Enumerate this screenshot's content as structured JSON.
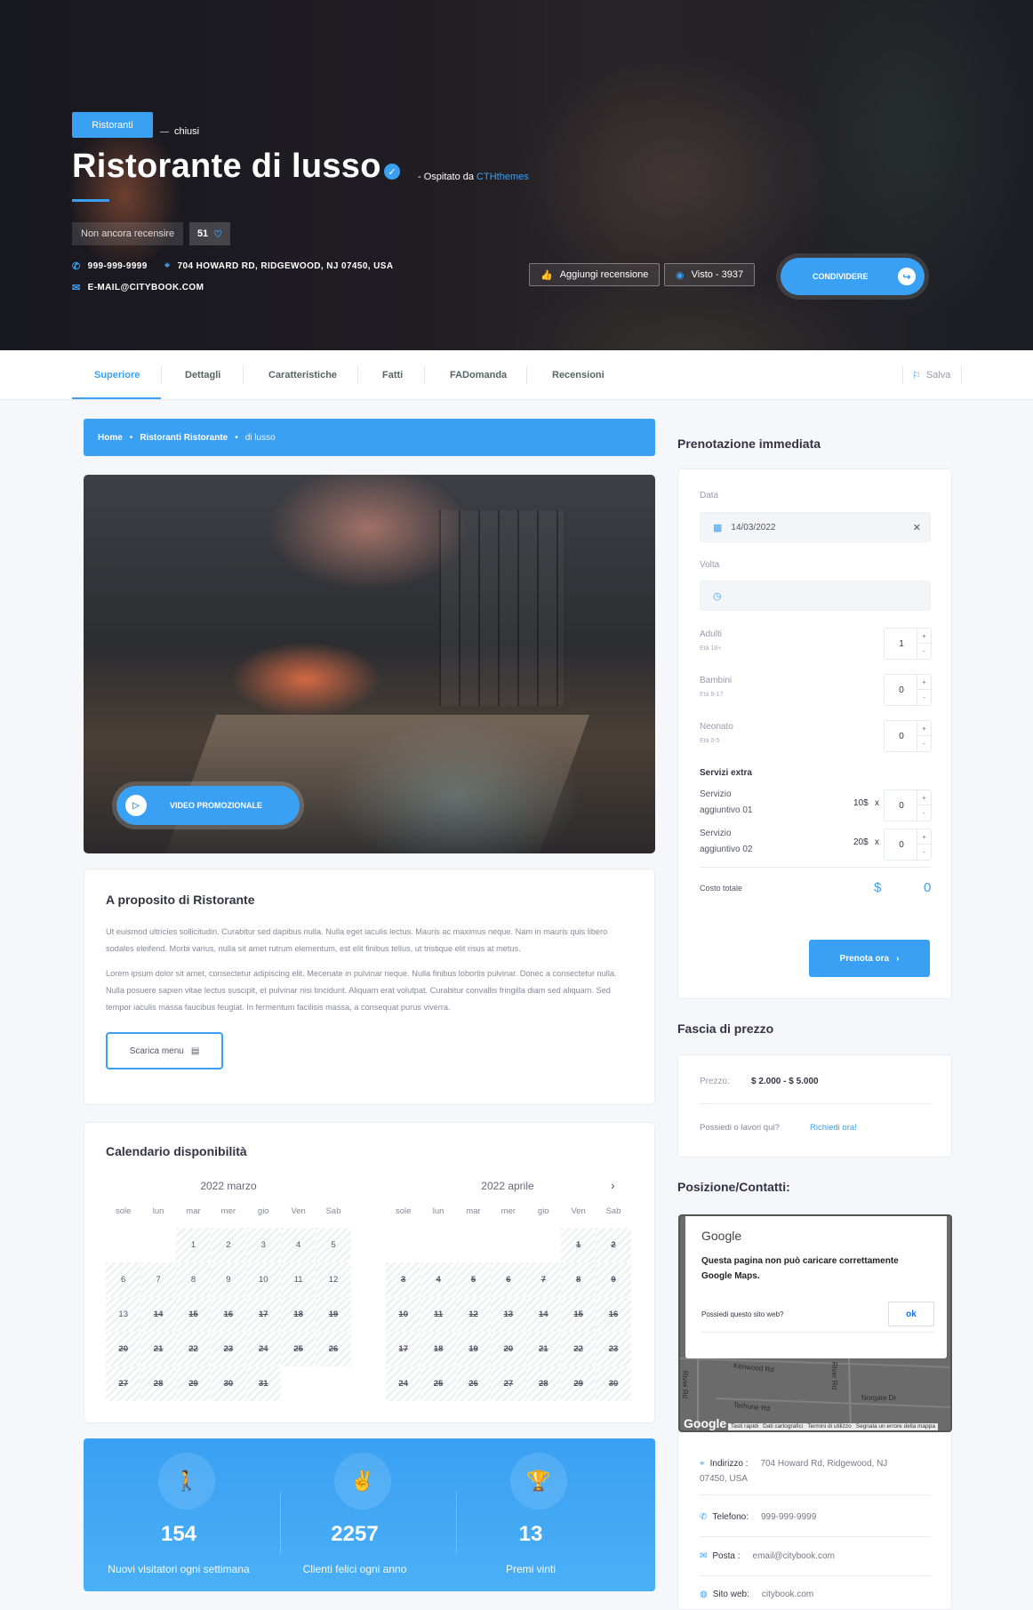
{
  "hero": {
    "category": "Ristoranti",
    "status": "chiusi",
    "title": "Ristorante di lusso",
    "hosted_prefix": "- Ospitato da",
    "hosted_by": "CTHthemes",
    "review_text": "Non ancora recensire",
    "rating": "51",
    "phone": "999-999-9999",
    "address": "704 HOWARD RD, RIDGEWOOD, NJ 07450, USA",
    "email": "E-MAIL@CITYBOOK.COM",
    "add_review": "Aggiungi recensione",
    "views": "Visto - 3937",
    "share": "CONDIVIDERE"
  },
  "tabs": [
    "Superiore",
    "Dettagli",
    "Caratteristiche",
    "Fatti",
    "FADomanda",
    "Recensioni"
  ],
  "save_label": "Salva",
  "breadcrumb": {
    "home": "Home",
    "category": "Ristoranti Ristorante",
    "current": "di lusso"
  },
  "video_label": "VIDEO PROMOZIONALE",
  "about": {
    "title": "A proposito di Ristorante",
    "p1": "Ut euismod ultricies sollicitudin. Curabitur sed dapibus nulla. Nulla eget iaculis lectus. Mauris ac maximus neque. Nam in mauris quis libero sodales eleifend. Morbi varius, nulla sit amet rutrum elementum, est elit finibus tellus, ut tristique elit risus at metus.",
    "p2": "Lorem ipsum dolor sit amet, consectetur adipiscing elit. Mecenate in pulvinar neque. Nulla finibus lobortis pulvinar. Donec a consectetur nulla. Nulla posuere sapien vitae lectus suscipit, et pulvinar nisi tincidunt. Aliquam erat volutpat. Curabitur convallis fringilla diam sed aliquam. Sed tempor iaculis massa faucibus feugiat. In fermentum facilisis massa, a consequat purus viverra.",
    "download": "Scarica menu"
  },
  "calendar": {
    "title": "Calendario disponibilità",
    "weekdays": [
      "sole",
      "lun",
      "mar",
      "mer",
      "gio",
      "Ven",
      "Sab"
    ],
    "months": [
      {
        "name": "2022 marzo",
        "offset": 2,
        "days": 31,
        "struck_from": 14
      },
      {
        "name": "2022 aprile",
        "offset": 5,
        "days": 30,
        "struck_from": 1
      }
    ],
    "next": "›"
  },
  "stats": [
    {
      "icon": "person-icon",
      "glyph": "🚶",
      "value": "154",
      "label": "Nuovi visitatori ogni settimana"
    },
    {
      "icon": "hand-icon",
      "glyph": "✌",
      "value": "2257",
      "label": "Clienti felici ogni anno"
    },
    {
      "icon": "trophy-icon",
      "glyph": "🏆",
      "value": "13",
      "label": "Premi vinti"
    }
  ],
  "booking": {
    "title": "Prenotazione immediata",
    "date_label": "Data",
    "date_value": "14/03/2022",
    "time_label": "Volta",
    "adults": {
      "label": "Adulti",
      "sub": "Età 18+",
      "value": "1"
    },
    "children": {
      "label": "Bambini",
      "sub": "Età 6-17",
      "value": "0"
    },
    "infants": {
      "label": "Neonato",
      "sub": "Età 0-5",
      "value": "0"
    },
    "extras_title": "Servizi extra",
    "extras": [
      {
        "name1": "Servizio",
        "name2": "aggiuntivo 01",
        "price": "10$",
        "value": "0"
      },
      {
        "name1": "Servizio",
        "name2": "aggiuntivo 02",
        "price": "20$",
        "value": "0"
      }
    ],
    "times": "x",
    "total_label": "Costo totale",
    "currency": "$",
    "total": "0",
    "book_btn": "Prenota ora"
  },
  "price": {
    "title": "Fascia di prezzo",
    "label": "Prezzo:",
    "range": "$ 2.000 - $ 5.000",
    "own_q": "Possiedi o lavori qui?",
    "claim": "Richiedi ora!"
  },
  "location": {
    "title": "Posizione/Contatti:",
    "map_brand": "Google",
    "map_error": "Questa pagina non può caricare correttamente Google Maps.",
    "map_question": "Possiedi questo sito web?",
    "map_ok": "ok",
    "roads": [
      "Kenwood Rd",
      "Terhune Rd",
      "Norgate Dr",
      "River Rd",
      "River Rd"
    ],
    "map_footer": [
      "Tasti rapidi",
      "Dati cartografici",
      "Termini di utilizzo",
      "Segnala un errore della mappa"
    ],
    "address_label": "Indirizzo :",
    "address": "704 Howard Rd, Ridgewood, NJ",
    "address2": "07450, USA",
    "phone_label": "Telefono:",
    "phone": "999-999-9999",
    "mail_label": "Posta :",
    "mail": "email@citybook.com",
    "web_label": "Sito web:",
    "web": "citybook.com"
  }
}
